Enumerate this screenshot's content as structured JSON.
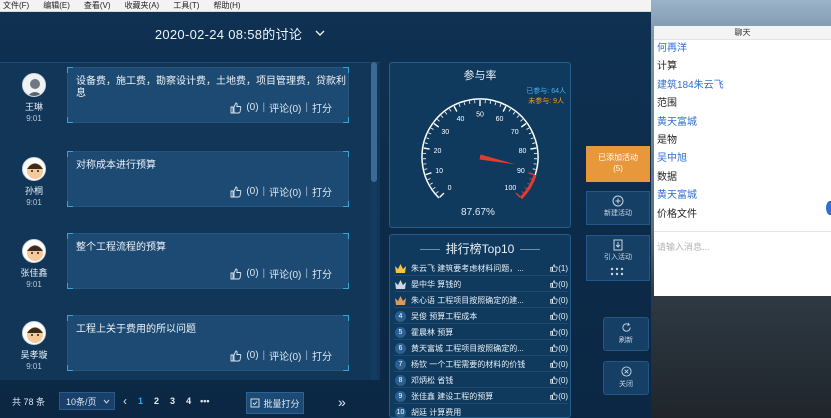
{
  "menu": [
    "文件(F)",
    "编辑(E)",
    "查看(V)",
    "收藏夹(A)",
    "工具(T)",
    "帮助(H)"
  ],
  "header": {
    "title": "2020-02-24 08:58的讨论"
  },
  "posts": [
    {
      "author": "王琳",
      "time": "9:01",
      "text": "设备费，施工费，勘察设计费，土地费，项目管理费，贷款利息",
      "likes": "(0)",
      "comment": "评论(0)",
      "score": "打分"
    },
    {
      "author": "孙桐",
      "time": "9:01",
      "text": "对称成本进行预算",
      "likes": "(0)",
      "comment": "评论(0)",
      "score": "打分"
    },
    {
      "author": "张佳鑫",
      "time": "9:01",
      "text": "整个工程流程的预算",
      "likes": "(0)",
      "comment": "评论(0)",
      "score": "打分"
    },
    {
      "author": "吴孝璇",
      "time": "9:01",
      "text": "工程上关于费用的所以问题",
      "likes": "(0)",
      "comment": "评论(0)",
      "score": "打分"
    }
  ],
  "pager": {
    "total": "共 78 条",
    "page_size": "10条/页",
    "pages": [
      "1",
      "2",
      "3",
      "4"
    ],
    "active_page": "1",
    "dots": "•••",
    "batch_score": "批量打分"
  },
  "gauge": {
    "title": "参与率",
    "legend_participated": "已参与: 64人",
    "legend_not": "未参与: 9人",
    "percent_label": "87.67%",
    "value": 87.67,
    "ticks": [
      "0",
      "10",
      "20",
      "30",
      "40",
      "50",
      "60",
      "70",
      "80",
      "90",
      "100"
    ],
    "colors": {
      "arc": "#ffffff",
      "danger": "#e33b2e",
      "needle": "#e33b2e"
    }
  },
  "ranking": {
    "title": "排行榜Top10",
    "rows": [
      {
        "rank": "1",
        "text": "朱云飞 建筑要考虑材料问题，...",
        "likes": "(1)"
      },
      {
        "rank": "2",
        "text": "晏中华 算钱的",
        "likes": "(0)"
      },
      {
        "rank": "3",
        "text": "朱心语 工程项目按照确定的建...",
        "likes": "(0)"
      },
      {
        "rank": "4",
        "text": "吴俊 预算工程成本",
        "likes": "(0)"
      },
      {
        "rank": "5",
        "text": "霍晨林 预算",
        "likes": "(0)"
      },
      {
        "rank": "6",
        "text": "黄天富城 工程项目按照确定的...",
        "likes": "(0)"
      },
      {
        "rank": "7",
        "text": "杨钦 一个工程需要的材料的价钱",
        "likes": "(0)"
      },
      {
        "rank": "8",
        "text": "邓炳松 省钱",
        "likes": "(0)"
      },
      {
        "rank": "9",
        "text": "张佳鑫 建设工程的预算",
        "likes": "(0)"
      },
      {
        "rank": "10",
        "text": "胡廷 计算费用",
        "likes": ""
      }
    ]
  },
  "side": {
    "added_activity": "已添加活动",
    "added_count": "(5)",
    "new_activity": "新建活动",
    "import_activity": "引入活动",
    "refresh": "刷新",
    "close": "关闭"
  },
  "chat": {
    "title": "聊天",
    "lines": [
      {
        "kind": "name",
        "text": "何再洋"
      },
      {
        "kind": "msg",
        "text": "计算"
      },
      {
        "kind": "name",
        "text": "建筑184朱云飞"
      },
      {
        "kind": "msg",
        "text": "范围"
      },
      {
        "kind": "name",
        "text": "黄天富城"
      },
      {
        "kind": "msg",
        "text": "是物"
      },
      {
        "kind": "name",
        "text": "吴中旭"
      },
      {
        "kind": "msg",
        "text": "数据"
      },
      {
        "kind": "name",
        "text": "黄天富城"
      },
      {
        "kind": "msg",
        "text": "价格文件"
      }
    ],
    "input_placeholder": "请输入消息..."
  }
}
